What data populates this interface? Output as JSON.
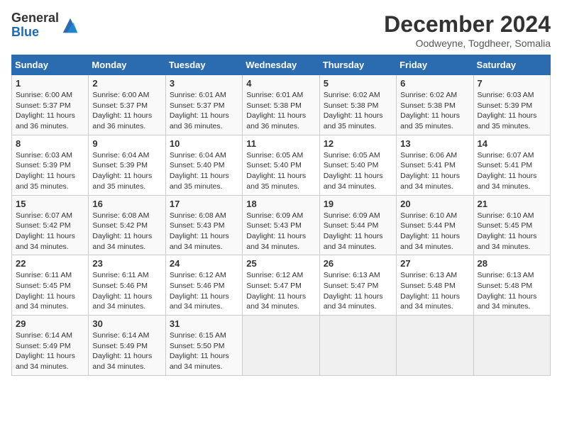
{
  "header": {
    "logo_general": "General",
    "logo_blue": "Blue",
    "month_title": "December 2024",
    "location": "Oodweyne, Togdheer, Somalia"
  },
  "weekdays": [
    "Sunday",
    "Monday",
    "Tuesday",
    "Wednesday",
    "Thursday",
    "Friday",
    "Saturday"
  ],
  "weeks": [
    [
      {
        "day": "1",
        "sunrise": "6:00 AM",
        "sunset": "5:37 PM",
        "daylight": "11 hours and 36 minutes."
      },
      {
        "day": "2",
        "sunrise": "6:00 AM",
        "sunset": "5:37 PM",
        "daylight": "11 hours and 36 minutes."
      },
      {
        "day": "3",
        "sunrise": "6:01 AM",
        "sunset": "5:37 PM",
        "daylight": "11 hours and 36 minutes."
      },
      {
        "day": "4",
        "sunrise": "6:01 AM",
        "sunset": "5:38 PM",
        "daylight": "11 hours and 36 minutes."
      },
      {
        "day": "5",
        "sunrise": "6:02 AM",
        "sunset": "5:38 PM",
        "daylight": "11 hours and 35 minutes."
      },
      {
        "day": "6",
        "sunrise": "6:02 AM",
        "sunset": "5:38 PM",
        "daylight": "11 hours and 35 minutes."
      },
      {
        "day": "7",
        "sunrise": "6:03 AM",
        "sunset": "5:39 PM",
        "daylight": "11 hours and 35 minutes."
      }
    ],
    [
      {
        "day": "8",
        "sunrise": "6:03 AM",
        "sunset": "5:39 PM",
        "daylight": "11 hours and 35 minutes."
      },
      {
        "day": "9",
        "sunrise": "6:04 AM",
        "sunset": "5:39 PM",
        "daylight": "11 hours and 35 minutes."
      },
      {
        "day": "10",
        "sunrise": "6:04 AM",
        "sunset": "5:40 PM",
        "daylight": "11 hours and 35 minutes."
      },
      {
        "day": "11",
        "sunrise": "6:05 AM",
        "sunset": "5:40 PM",
        "daylight": "11 hours and 35 minutes."
      },
      {
        "day": "12",
        "sunrise": "6:05 AM",
        "sunset": "5:40 PM",
        "daylight": "11 hours and 34 minutes."
      },
      {
        "day": "13",
        "sunrise": "6:06 AM",
        "sunset": "5:41 PM",
        "daylight": "11 hours and 34 minutes."
      },
      {
        "day": "14",
        "sunrise": "6:07 AM",
        "sunset": "5:41 PM",
        "daylight": "11 hours and 34 minutes."
      }
    ],
    [
      {
        "day": "15",
        "sunrise": "6:07 AM",
        "sunset": "5:42 PM",
        "daylight": "11 hours and 34 minutes."
      },
      {
        "day": "16",
        "sunrise": "6:08 AM",
        "sunset": "5:42 PM",
        "daylight": "11 hours and 34 minutes."
      },
      {
        "day": "17",
        "sunrise": "6:08 AM",
        "sunset": "5:43 PM",
        "daylight": "11 hours and 34 minutes."
      },
      {
        "day": "18",
        "sunrise": "6:09 AM",
        "sunset": "5:43 PM",
        "daylight": "11 hours and 34 minutes."
      },
      {
        "day": "19",
        "sunrise": "6:09 AM",
        "sunset": "5:44 PM",
        "daylight": "11 hours and 34 minutes."
      },
      {
        "day": "20",
        "sunrise": "6:10 AM",
        "sunset": "5:44 PM",
        "daylight": "11 hours and 34 minutes."
      },
      {
        "day": "21",
        "sunrise": "6:10 AM",
        "sunset": "5:45 PM",
        "daylight": "11 hours and 34 minutes."
      }
    ],
    [
      {
        "day": "22",
        "sunrise": "6:11 AM",
        "sunset": "5:45 PM",
        "daylight": "11 hours and 34 minutes."
      },
      {
        "day": "23",
        "sunrise": "6:11 AM",
        "sunset": "5:46 PM",
        "daylight": "11 hours and 34 minutes."
      },
      {
        "day": "24",
        "sunrise": "6:12 AM",
        "sunset": "5:46 PM",
        "daylight": "11 hours and 34 minutes."
      },
      {
        "day": "25",
        "sunrise": "6:12 AM",
        "sunset": "5:47 PM",
        "daylight": "11 hours and 34 minutes."
      },
      {
        "day": "26",
        "sunrise": "6:13 AM",
        "sunset": "5:47 PM",
        "daylight": "11 hours and 34 minutes."
      },
      {
        "day": "27",
        "sunrise": "6:13 AM",
        "sunset": "5:48 PM",
        "daylight": "11 hours and 34 minutes."
      },
      {
        "day": "28",
        "sunrise": "6:13 AM",
        "sunset": "5:48 PM",
        "daylight": "11 hours and 34 minutes."
      }
    ],
    [
      {
        "day": "29",
        "sunrise": "6:14 AM",
        "sunset": "5:49 PM",
        "daylight": "11 hours and 34 minutes."
      },
      {
        "day": "30",
        "sunrise": "6:14 AM",
        "sunset": "5:49 PM",
        "daylight": "11 hours and 34 minutes."
      },
      {
        "day": "31",
        "sunrise": "6:15 AM",
        "sunset": "5:50 PM",
        "daylight": "11 hours and 34 minutes."
      },
      null,
      null,
      null,
      null
    ]
  ]
}
